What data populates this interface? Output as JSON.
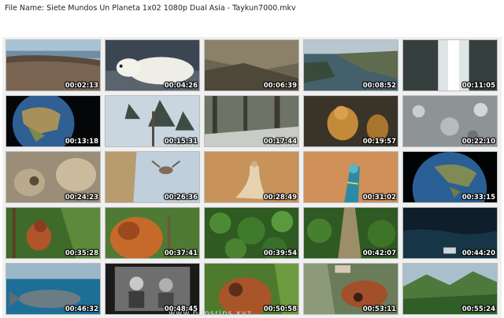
{
  "header": {
    "file_name": "File Name: Siete Mundos Un Planeta 1x02 1080p Dual Asia - Taykun7000.mkv"
  },
  "thumbnails": [
    {
      "time": "00:02:13",
      "scene": "walrus-beach"
    },
    {
      "time": "00:04:26",
      "scene": "polar-bear"
    },
    {
      "time": "00:06:39",
      "scene": "rocky-cliff"
    },
    {
      "time": "00:08:52",
      "scene": "coastal-lake"
    },
    {
      "time": "00:11:05",
      "scene": "waterfall"
    },
    {
      "time": "00:13:18",
      "scene": "earth-asia"
    },
    {
      "time": "00:15:31",
      "scene": "snowy-pine"
    },
    {
      "time": "00:17:44",
      "scene": "snowy-forest"
    },
    {
      "time": "00:19:57",
      "scene": "golden-monkey"
    },
    {
      "time": "00:22:10",
      "scene": "snow-rocks"
    },
    {
      "time": "00:24:23",
      "scene": "rock-monkey"
    },
    {
      "time": "00:26:36",
      "scene": "bird-cliff"
    },
    {
      "time": "00:28:49",
      "scene": "lizard-desert"
    },
    {
      "time": "00:31:02",
      "scene": "blue-lizard"
    },
    {
      "time": "00:33:15",
      "scene": "earth-southeast-asia"
    },
    {
      "time": "00:35:28",
      "scene": "orangutan-baby"
    },
    {
      "time": "00:37:41",
      "scene": "orangutan-fur"
    },
    {
      "time": "00:39:54",
      "scene": "jungle-canopy"
    },
    {
      "time": "00:42:07",
      "scene": "jungle-path"
    },
    {
      "time": "00:44:20",
      "scene": "night-sea"
    },
    {
      "time": "00:46:32",
      "scene": "whale-shark"
    },
    {
      "time": "00:48:45",
      "scene": "bw-photo"
    },
    {
      "time": "00:50:58",
      "scene": "orangutan-closeup"
    },
    {
      "time": "00:53:11",
      "scene": "orangutan-rescue"
    },
    {
      "time": "00:55:24",
      "scene": "jungle-mountains"
    }
  ],
  "watermark": "www.bdpsrips.xyz"
}
